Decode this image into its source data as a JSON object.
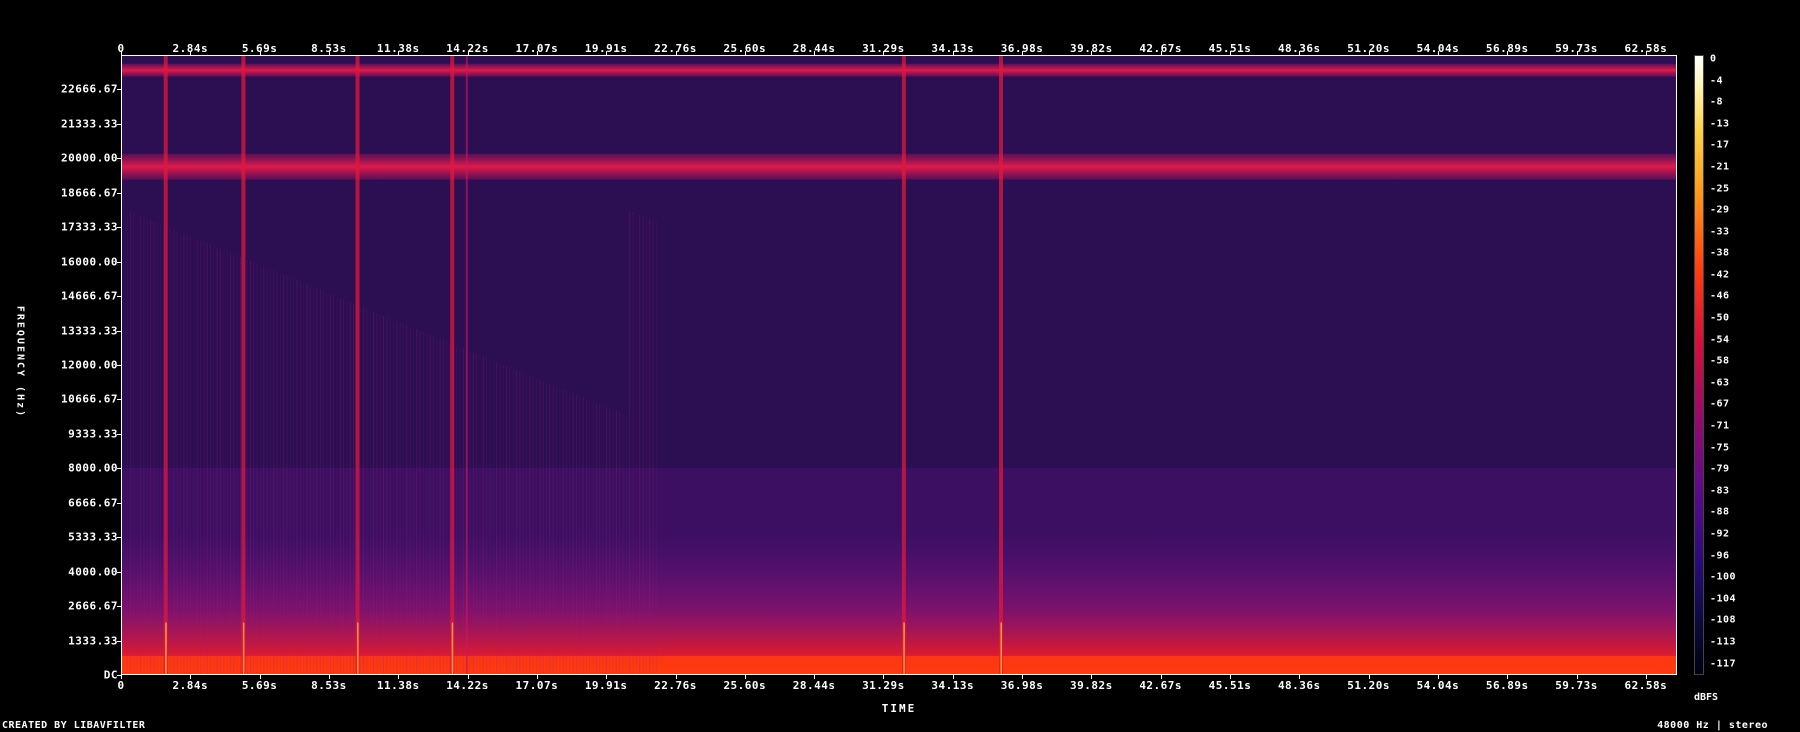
{
  "chart_data": {
    "type": "heatmap",
    "subtype": "spectrogram",
    "xlabel": "TIME",
    "ylabel": "FREQUENCY (Hz)",
    "x_ticks": [
      "0",
      "2.84s",
      "5.69s",
      "8.53s",
      "11.38s",
      "14.22s",
      "17.07s",
      "19.91s",
      "22.76s",
      "25.60s",
      "28.44s",
      "31.29s",
      "34.13s",
      "36.98s",
      "39.82s",
      "42.67s",
      "45.51s",
      "48.36s",
      "51.20s",
      "54.04s",
      "56.89s",
      "59.73s",
      "62.58s"
    ],
    "xlim": [
      0,
      64
    ],
    "y_ticks": [
      "DC",
      "1333.33",
      "2666.67",
      "4000.00",
      "5333.33",
      "6666.67",
      "8000.00",
      "9333.33",
      "10666.67",
      "12000.00",
      "13333.33",
      "14666.67",
      "16000.00",
      "17333.33",
      "18666.67",
      "20000.00",
      "21333.33",
      "22666.67"
    ],
    "ylim": [
      0,
      24000
    ],
    "colorbar_label": "dBFS",
    "colorbar_ticks": [
      "0",
      "-4",
      "-8",
      "-13",
      "-17",
      "-21",
      "-25",
      "-29",
      "-33",
      "-38",
      "-42",
      "-46",
      "-50",
      "-54",
      "-58",
      "-63",
      "-67",
      "-71",
      "-75",
      "-79",
      "-83",
      "-88",
      "-92",
      "-96",
      "-100",
      "-104",
      "-108",
      "-113",
      "-117"
    ],
    "colorbar_range": [
      -120,
      0
    ],
    "colormap": "fire",
    "features": {
      "bands_hz": [
        {
          "from": 19200,
          "to": 20200,
          "level_db": -55
        },
        {
          "from": 23200,
          "to": 23700,
          "level_db": -58
        }
      ],
      "low_freq_energy": {
        "below_hz": 700,
        "level_db": -40
      },
      "transients_s": [
        1.8,
        5.0,
        9.7,
        13.6,
        32.2,
        36.2
      ],
      "onsets_s": [
        14.2
      ]
    }
  },
  "footer": {
    "credit": "CREATED BY LIBAVFILTER",
    "info": "48000 Hz | stereo"
  },
  "colors": {
    "background": "#000000",
    "text": "#ffffff",
    "base": "#2a0d4a"
  }
}
